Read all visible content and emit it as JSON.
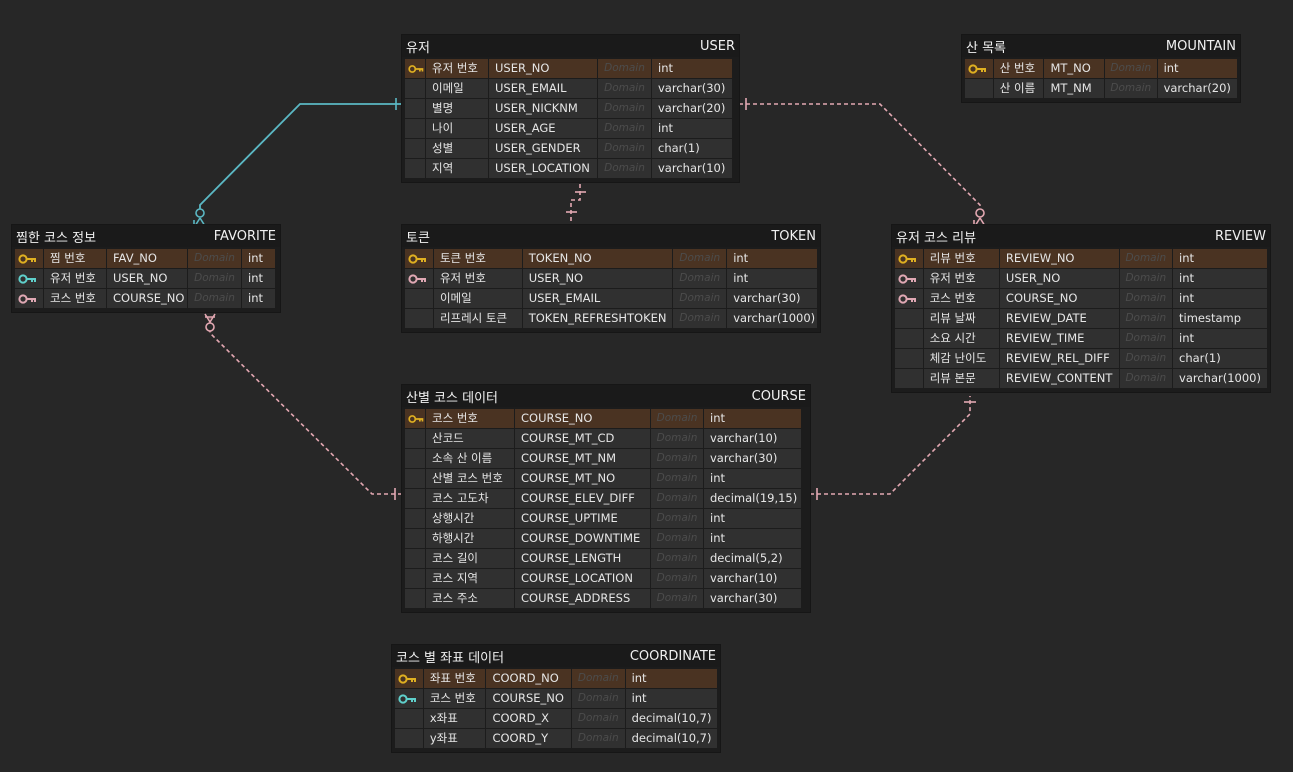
{
  "colors": {
    "background": "#272727",
    "pk_row": "#4a3322",
    "pk_key_icon": "#e0b021",
    "fk_key_icon": "#e0a8b4",
    "pfk_key_icon": "#5fd0cc",
    "identifying_line": "#5bb8c4",
    "non_identifying_line": "#e3a8b2"
  },
  "entities": [
    {
      "id": "user",
      "title_kr": "유저",
      "title_en": "USER",
      "rows": [
        {
          "key": "pk",
          "kr": "유저 번호",
          "en": "USER_NO",
          "domain": "Domain",
          "type": "int"
        },
        {
          "key": "",
          "kr": "이메일",
          "en": "USER_EMAIL",
          "domain": "Domain",
          "type": "varchar(30)"
        },
        {
          "key": "",
          "kr": "별명",
          "en": "USER_NICKNM",
          "domain": "Domain",
          "type": "varchar(20)"
        },
        {
          "key": "",
          "kr": "나이",
          "en": "USER_AGE",
          "domain": "Domain",
          "type": "int"
        },
        {
          "key": "",
          "kr": "성별",
          "en": "USER_GENDER",
          "domain": "Domain",
          "type": "char(1)"
        },
        {
          "key": "",
          "kr": "지역",
          "en": "USER_LOCATION",
          "domain": "Domain",
          "type": "varchar(10)"
        }
      ]
    },
    {
      "id": "mountain",
      "title_kr": "산 목록",
      "title_en": "MOUNTAIN",
      "rows": [
        {
          "key": "pk",
          "kr": "산 번호",
          "en": "MT_NO",
          "domain": "Domain",
          "type": "int"
        },
        {
          "key": "",
          "kr": "산 이름",
          "en": "MT_NM",
          "domain": "Domain",
          "type": "varchar(20)"
        }
      ]
    },
    {
      "id": "favorite",
      "title_kr": "찜한 코스 정보",
      "title_en": "FAVORITE",
      "rows": [
        {
          "key": "pk",
          "kr": "찜 번호",
          "en": "FAV_NO",
          "domain": "Domain",
          "type": "int"
        },
        {
          "key": "pfk",
          "kr": "유저 번호",
          "en": "USER_NO",
          "domain": "Domain",
          "type": "int"
        },
        {
          "key": "fk",
          "kr": "코스 번호",
          "en": "COURSE_NO",
          "domain": "Domain",
          "type": "int"
        }
      ]
    },
    {
      "id": "token",
      "title_kr": "토큰",
      "title_en": "TOKEN",
      "rows": [
        {
          "key": "pk",
          "kr": "토큰 번호",
          "en": "TOKEN_NO",
          "domain": "Domain",
          "type": "int"
        },
        {
          "key": "fk",
          "kr": "유저 번호",
          "en": "USER_NO",
          "domain": "Domain",
          "type": "int"
        },
        {
          "key": "",
          "kr": "이메일",
          "en": "USER_EMAIL",
          "domain": "Domain",
          "type": "varchar(30)"
        },
        {
          "key": "",
          "kr": "리프레시 토큰",
          "en": "TOKEN_REFRESHTOKEN",
          "domain": "Domain",
          "type": "varchar(1000)"
        }
      ]
    },
    {
      "id": "review",
      "title_kr": "유저 코스 리뷰",
      "title_en": "REVIEW",
      "rows": [
        {
          "key": "pk",
          "kr": "리뷰 번호",
          "en": "REVIEW_NO",
          "domain": "Domain",
          "type": "int"
        },
        {
          "key": "fk",
          "kr": "유저 번호",
          "en": "USER_NO",
          "domain": "Domain",
          "type": "int"
        },
        {
          "key": "fk",
          "kr": "코스 번호",
          "en": "COURSE_NO",
          "domain": "Domain",
          "type": "int"
        },
        {
          "key": "",
          "kr": "리뷰 날짜",
          "en": "REVIEW_DATE",
          "domain": "Domain",
          "type": "timestamp"
        },
        {
          "key": "",
          "kr": "소요 시간",
          "en": "REVIEW_TIME",
          "domain": "Domain",
          "type": "int"
        },
        {
          "key": "",
          "kr": "체감 난이도",
          "en": "REVIEW_REL_DIFF",
          "domain": "Domain",
          "type": "char(1)"
        },
        {
          "key": "",
          "kr": "리뷰 본문",
          "en": "REVIEW_CONTENT",
          "domain": "Domain",
          "type": "varchar(1000)"
        }
      ]
    },
    {
      "id": "course",
      "title_kr": "산별 코스 데이터",
      "title_en": "COURSE",
      "rows": [
        {
          "key": "pk",
          "kr": "코스 번호",
          "en": "COURSE_NO",
          "domain": "Domain",
          "type": "int"
        },
        {
          "key": "",
          "kr": "산코드",
          "en": "COURSE_MT_CD",
          "domain": "Domain",
          "type": "varchar(10)"
        },
        {
          "key": "",
          "kr": "소속 산 이름",
          "en": "COURSE_MT_NM",
          "domain": "Domain",
          "type": "varchar(30)"
        },
        {
          "key": "",
          "kr": "산별 코스 번호",
          "en": "COURSE_MT_NO",
          "domain": "Domain",
          "type": "int"
        },
        {
          "key": "",
          "kr": "코스 고도차",
          "en": "COURSE_ELEV_DIFF",
          "domain": "Domain",
          "type": "decimal(19,15)"
        },
        {
          "key": "",
          "kr": "상행시간",
          "en": "COURSE_UPTIME",
          "domain": "Domain",
          "type": "int"
        },
        {
          "key": "",
          "kr": "하행시간",
          "en": "COURSE_DOWNTIME",
          "domain": "Domain",
          "type": "int"
        },
        {
          "key": "",
          "kr": "코스 길이",
          "en": "COURSE_LENGTH",
          "domain": "Domain",
          "type": "decimal(5,2)"
        },
        {
          "key": "",
          "kr": "코스 지역",
          "en": "COURSE_LOCATION",
          "domain": "Domain",
          "type": "varchar(10)"
        },
        {
          "key": "",
          "kr": "코스 주소",
          "en": "COURSE_ADDRESS",
          "domain": "Domain",
          "type": "varchar(30)"
        }
      ]
    },
    {
      "id": "coordinate",
      "title_kr": "코스 별 좌표 데이터",
      "title_en": "COORDINATE",
      "rows": [
        {
          "key": "pk",
          "kr": "좌표 번호",
          "en": "COORD_NO",
          "domain": "Domain",
          "type": "int"
        },
        {
          "key": "pfk",
          "kr": "코스 번호",
          "en": "COURSE_NO",
          "domain": "Domain",
          "type": "int"
        },
        {
          "key": "",
          "kr": "x좌표",
          "en": "COORD_X",
          "domain": "Domain",
          "type": "decimal(10,7)"
        },
        {
          "key": "",
          "kr": "y좌표",
          "en": "COORD_Y",
          "domain": "Domain",
          "type": "decimal(10,7)"
        }
      ]
    }
  ],
  "relationships": [
    {
      "from": "user",
      "to": "favorite",
      "style": "identifying"
    },
    {
      "from": "user",
      "to": "token",
      "style": "non-identifying"
    },
    {
      "from": "user",
      "to": "review",
      "style": "non-identifying"
    },
    {
      "from": "course",
      "to": "favorite",
      "style": "non-identifying"
    },
    {
      "from": "course",
      "to": "review",
      "style": "non-identifying"
    }
  ]
}
